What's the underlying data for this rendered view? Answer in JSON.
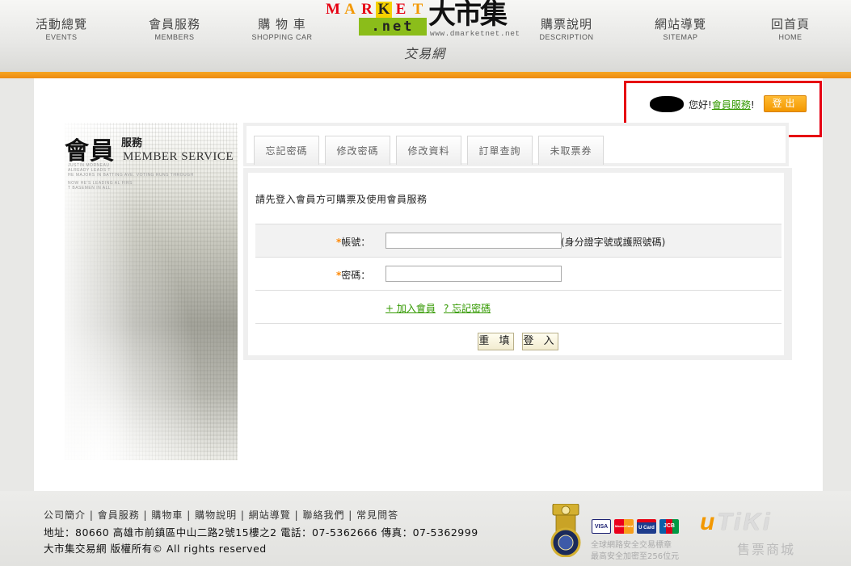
{
  "header": {
    "nav": [
      {
        "zh": "活動總覽",
        "en": "EVENTS"
      },
      {
        "zh": "會員服務",
        "en": "MEMBERS"
      },
      {
        "zh": "購 物 車",
        "en": "SHOPPING CAR"
      },
      {
        "zh": "購票說明",
        "en": "DESCRIPTION"
      },
      {
        "zh": "網站導覽",
        "en": "SITEMAP"
      },
      {
        "zh": "回首頁",
        "en": "HOME"
      }
    ],
    "logo": {
      "letters": [
        "M",
        "A",
        "R",
        "K",
        "E",
        "T"
      ],
      "net": ".net",
      "big": "大市集",
      "url": "www.dmarketnet.net",
      "sub": "交易網"
    }
  },
  "greeting": {
    "hello": "您好!",
    "link": "會員服務",
    "sep": "!",
    "logout": "登出"
  },
  "side": {
    "zh_big": "會員",
    "zh_small": "服務",
    "en": "MEMBER SERVICE",
    "tiny_lines": [
      "JUSTIN MORNEAU",
      "ALREADY LEADS T",
      "HE MAJORS IN BATTING AVE. VOTING RUNS THROUGH",
      "",
      "NOW HE'S LEADING AL FIRS",
      "T BASEMEN IN ALL"
    ]
  },
  "tabs": [
    "忘記密碼",
    "修改密碼",
    "修改資料",
    "訂單查詢",
    "未取票券"
  ],
  "form": {
    "notice": "請先登入會員方可購票及使用會員服務",
    "account_label": "帳號：",
    "account_hint": "(身分證字號或護照號碼)",
    "account_value": "",
    "password_label": "密碼：",
    "password_value": "",
    "required_mark": "*",
    "join_link": "+ 加入會員",
    "forgot_link": "? 忘記密碼",
    "reset_button": "重 填",
    "login_button": "登 入"
  },
  "footer": {
    "links": [
      "公司簡介",
      "會員服務",
      "購物車",
      "購物說明",
      "網站導覽",
      "聯絡我們",
      "常見問答"
    ],
    "address": "地址：80660 高雄市前鎮區中山二路2號15樓之2 電話：07-5362666 傳真：07-5362999",
    "copyright": "大市集交易網 版權所有© All rights reserved",
    "cards": [
      "VISA",
      "MasterCard",
      "U Card",
      "JCB"
    ],
    "secure_line1": "全球網路安全交易標章",
    "secure_line2": "最高安全加密至256位元",
    "brand": "uTiKi",
    "brand_sub": "售票商城"
  },
  "colors": {
    "accent_orange": "#f39800",
    "link_green": "#339900",
    "highlight_red": "#e60012",
    "logo_letters": [
      "#e60012",
      "#f39800",
      "#e60012",
      "#f5d100",
      "#e60012",
      "#f39800"
    ],
    "net_green": "#8bbd1a"
  }
}
